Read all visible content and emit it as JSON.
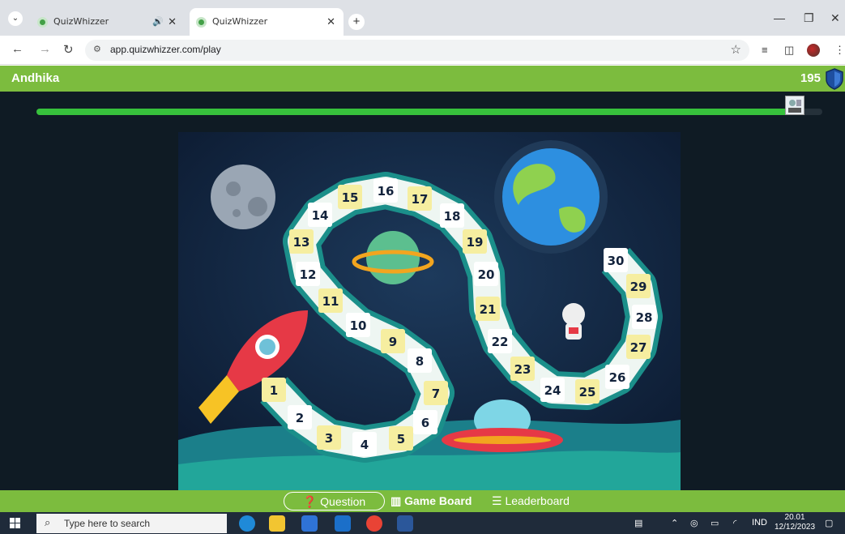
{
  "browser": {
    "tabs": [
      {
        "title": "QuizWhizzer",
        "audio": true,
        "active": false
      },
      {
        "title": "QuizWhizzer",
        "audio": false,
        "active": true
      }
    ],
    "url": "app.quizwhizzer.com/play",
    "new_tab_label": "+"
  },
  "header": {
    "username": "Andhika",
    "score": "195"
  },
  "progress": {
    "fraction": 0.96
  },
  "board": {
    "squares": [
      "1",
      "2",
      "3",
      "4",
      "5",
      "6",
      "7",
      "8",
      "9",
      "10",
      "11",
      "12",
      "13",
      "14",
      "15",
      "16",
      "17",
      "18",
      "19",
      "20",
      "21",
      "22",
      "23",
      "24",
      "25",
      "26",
      "27",
      "28",
      "29",
      "30"
    ]
  },
  "nav": {
    "question_label": "Question",
    "gameboard_label": "Game Board",
    "leaderboard_label": "Leaderboard"
  },
  "taskbar": {
    "search_placeholder": "Type here to search",
    "lang": "IND",
    "time": "20.01",
    "date": "12/12/2023"
  },
  "colors": {
    "header_green": "#7cbc3e",
    "progress_green": "#37c13c",
    "game_bg": "#0f1b24"
  }
}
